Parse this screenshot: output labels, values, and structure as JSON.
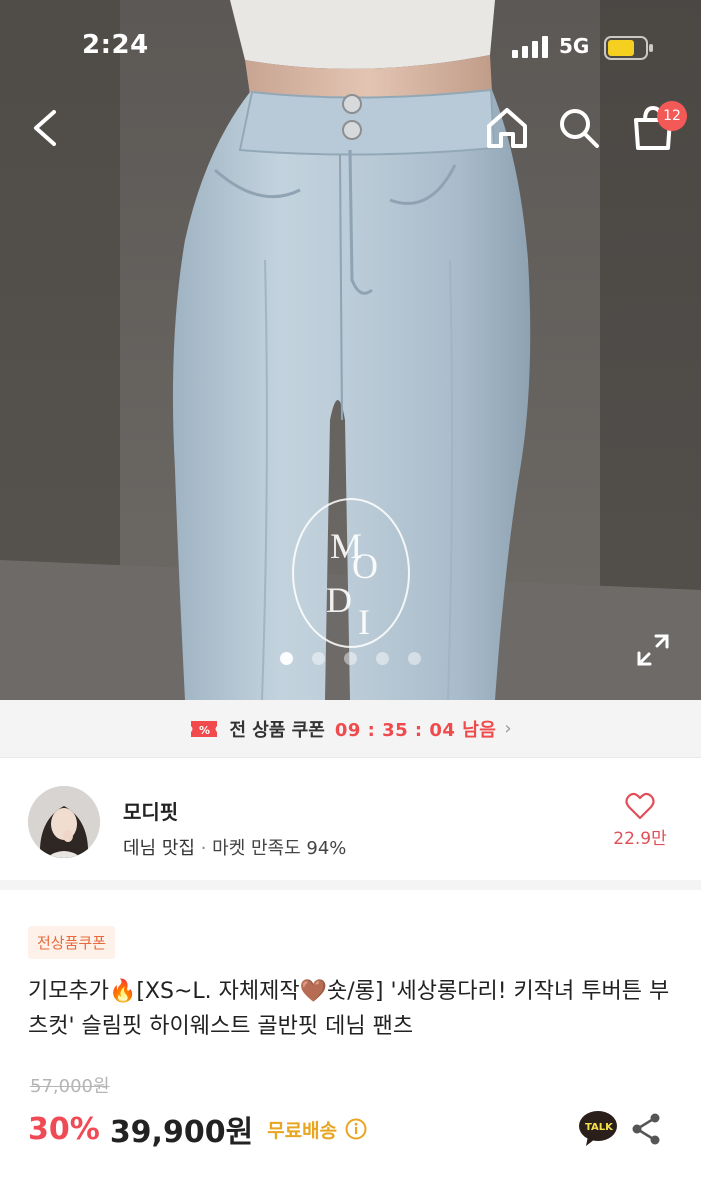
{
  "status_bar": {
    "time": "2:24",
    "network": "5G"
  },
  "nav": {
    "cart_count": "12"
  },
  "hero": {
    "logo_letters": [
      "M",
      "O",
      "D",
      "I"
    ],
    "slide_count": 5,
    "active_slide": 1
  },
  "coupon": {
    "icon": "coupon-ticket-icon",
    "label": "전 상품 쿠폰",
    "timer": "09 : 35 : 04 남음",
    "arrow": "›"
  },
  "shop": {
    "name": "모디핏",
    "tag": "데님 맛집",
    "separator": " · ",
    "satisfaction": "마켓 만족도 94%",
    "like_count": "22.9만"
  },
  "product": {
    "badge": "전상품쿠폰",
    "title": "기모추가🔥[XS~L. 자체제작🤎숏/롱] '세상롱다리! 키작녀 투버튼 부츠컷' 슬림핏 하이웨스트 골반핏 데님 팬츠",
    "original_price": "57,000원",
    "discount": "30%",
    "price": "39,900원",
    "shipping": "무료배송"
  },
  "colors": {
    "accent_red": "#f04a55",
    "badge_bg": "#fdf1ea",
    "badge_text": "#e86a3a",
    "shipping": "#e8a520",
    "cart_badge": "#f35a57"
  }
}
